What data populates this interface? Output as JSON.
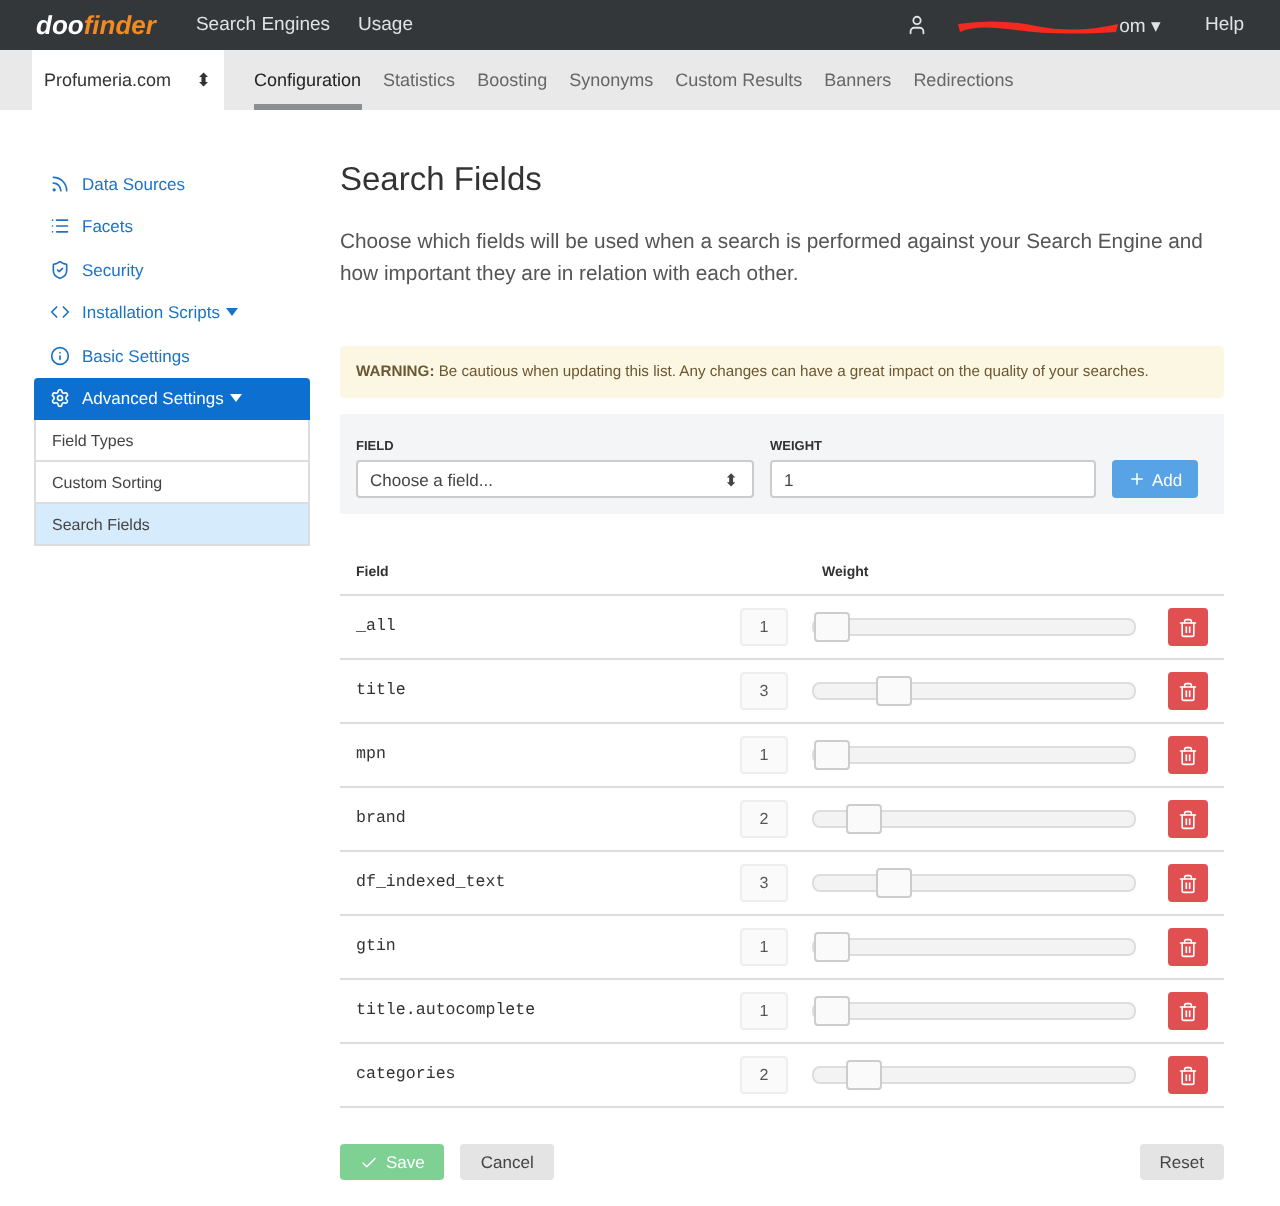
{
  "topbar": {
    "logo": {
      "part_1": "doo",
      "part_2": "finder"
    },
    "nav": [
      {
        "label": "Search Engines"
      },
      {
        "label": "Usage"
      }
    ],
    "account": {
      "label_tail": "om",
      "caret": "▾"
    },
    "help": "Help"
  },
  "subnav": {
    "engine_select": "Profumeria.com",
    "engine_select_arrows": "⬍",
    "tabs": [
      {
        "label": "Configuration",
        "selected": true
      },
      {
        "label": "Statistics",
        "selected": false
      },
      {
        "label": "Boosting",
        "selected": false
      },
      {
        "label": "Synonyms",
        "selected": false
      },
      {
        "label": "Custom Results",
        "selected": false
      },
      {
        "label": "Banners",
        "selected": false
      },
      {
        "label": "Redirections",
        "selected": false
      }
    ]
  },
  "sidebar": {
    "items": [
      {
        "label": "Data Sources",
        "dropdown": false,
        "selected": false
      },
      {
        "label": "Facets",
        "dropdown": false,
        "selected": false
      },
      {
        "label": "Security",
        "dropdown": false,
        "selected": false
      },
      {
        "label": "Installation Scripts",
        "dropdown": true,
        "selected": false
      },
      {
        "label": "Basic Settings",
        "dropdown": false,
        "selected": false
      },
      {
        "label": "Advanced Settings",
        "dropdown": true,
        "selected": true,
        "children": [
          {
            "label": "Field Types",
            "selected": false
          },
          {
            "label": "Custom Sorting",
            "selected": false
          },
          {
            "label": "Search Fields",
            "selected": true
          }
        ]
      }
    ]
  },
  "main": {
    "title": "Search Fields",
    "description": "Choose which fields will be used when a search is performed against your Search Engine and how important they are in relation with each other.",
    "warning": "**WARNING:** Be cautious when updating this list. Any changes can have a great impact on the quality of your searches.",
    "add_form": {
      "field_label": "FIELD",
      "field_placeholder": "Choose a field...",
      "field_select_arrows": "⬍",
      "weight_label": "WEIGHT",
      "weight_value": "1",
      "add_button": "Add"
    },
    "table": {
      "columns": [
        "Field",
        "Weight"
      ],
      "rows": [
        {
          "field": "_all",
          "weight": "1",
          "level": 0
        },
        {
          "field": "title",
          "weight": "3",
          "level": 0.22
        },
        {
          "field": "mpn",
          "weight": "1",
          "level": 0
        },
        {
          "field": "brand",
          "weight": "2",
          "level": 0.11
        },
        {
          "field": "df_indexed_text",
          "weight": "3",
          "level": 0.22
        },
        {
          "field": "gtin",
          "weight": "1",
          "level": 0
        },
        {
          "field": "title.autocomplete",
          "weight": "1",
          "level": 0
        },
        {
          "field": "categories",
          "weight": "2",
          "level": 0.11
        }
      ]
    },
    "buttons": {
      "save": "Save",
      "cancel": "Cancel",
      "reset": "Reset"
    }
  }
}
